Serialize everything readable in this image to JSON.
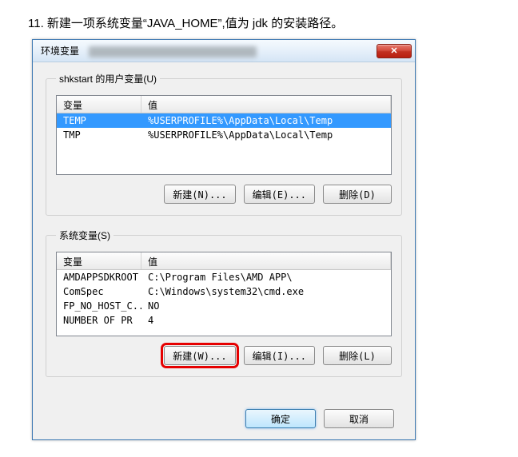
{
  "instruction": "11. 新建一项系统变量“JAVA_HOME”,值为 jdk 的安装路径。",
  "window": {
    "title": "环境变量",
    "close_symbol": "✕"
  },
  "user_vars": {
    "legend": "shkstart 的用户变量(U)",
    "headers": {
      "name": "变量",
      "value": "值"
    },
    "rows": [
      {
        "name": "TEMP",
        "value": "%USERPROFILE%\\AppData\\Local\\Temp",
        "selected": true
      },
      {
        "name": "TMP",
        "value": "%USERPROFILE%\\AppData\\Local\\Temp",
        "selected": false
      }
    ],
    "buttons": {
      "new": "新建(N)...",
      "edit": "编辑(E)...",
      "delete": "删除(D)"
    }
  },
  "sys_vars": {
    "legend": "系统变量(S)",
    "headers": {
      "name": "变量",
      "value": "值"
    },
    "rows": [
      {
        "name": "AMDAPPSDKROOT",
        "value": "C:\\Program Files\\AMD APP\\"
      },
      {
        "name": "ComSpec",
        "value": "C:\\Windows\\system32\\cmd.exe"
      },
      {
        "name": "FP_NO_HOST_C...",
        "value": "NO"
      },
      {
        "name": "NUMBER OF PR",
        "value": "4"
      }
    ],
    "buttons": {
      "new": "新建(W)...",
      "edit": "编辑(I)...",
      "delete": "删除(L)"
    }
  },
  "footer": {
    "ok": "确定",
    "cancel": "取消"
  }
}
